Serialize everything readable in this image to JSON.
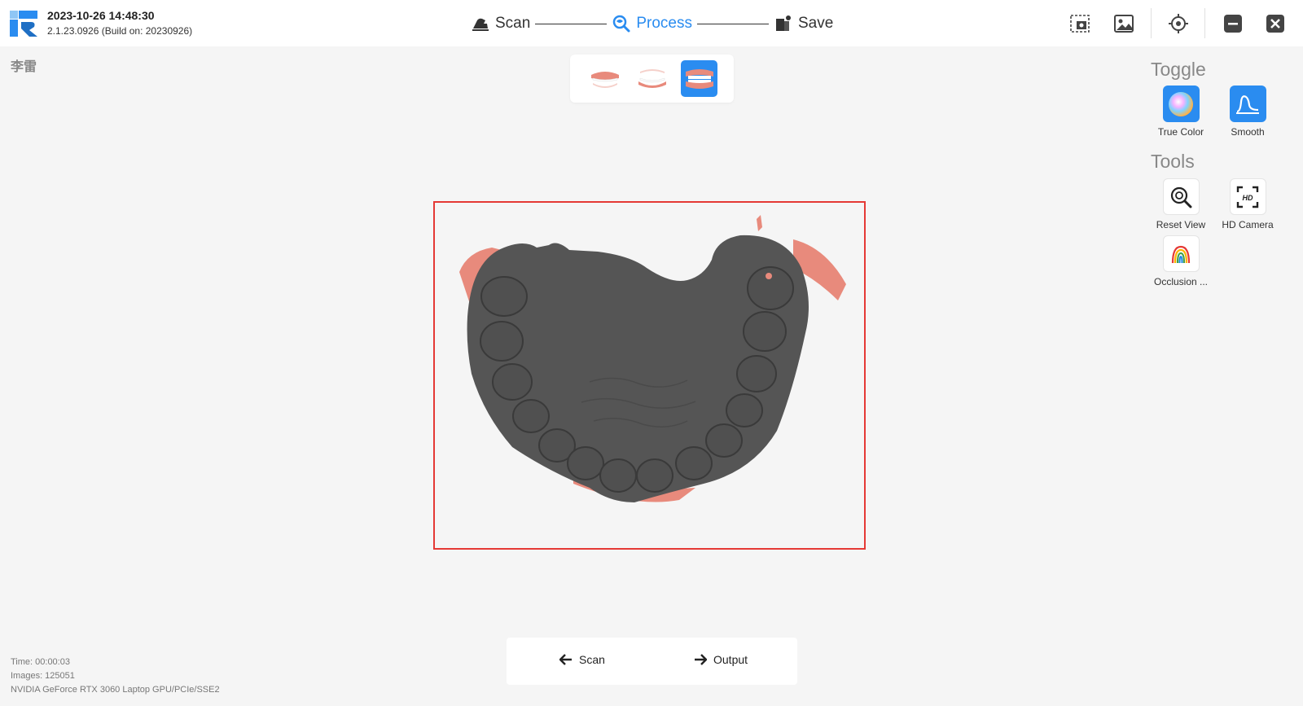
{
  "header": {
    "timestamp": "2023-10-26 14:48:30",
    "version": "2.1.23.0926 (Build on: 20230926)",
    "steps": [
      {
        "label": "Scan",
        "icon": "scanner-icon"
      },
      {
        "label": "Process",
        "icon": "process-icon",
        "active": true
      },
      {
        "label": "Save",
        "icon": "save-icon"
      }
    ],
    "right_icons": [
      "screenshot-icon",
      "image-gallery-icon",
      "target-icon",
      "minimize-icon",
      "close-icon"
    ]
  },
  "patient": {
    "name": "李雷"
  },
  "arch_selector": {
    "options": [
      "upper-jaw",
      "lower-jaw",
      "full-occlusion"
    ],
    "selected": "full-occlusion"
  },
  "right_panel": {
    "toggle_title": "Toggle",
    "toggles": [
      {
        "label": "True Color",
        "icon": "true-color-icon"
      },
      {
        "label": "Smooth",
        "icon": "smooth-icon"
      }
    ],
    "tools_title": "Tools",
    "tools": [
      {
        "label": "Reset View",
        "icon": "reset-view-icon"
      },
      {
        "label": "HD Camera",
        "icon": "hd-camera-icon"
      },
      {
        "label": "Occlusion ...",
        "icon": "occlusion-icon"
      }
    ]
  },
  "bottom_nav": {
    "back_label": "Scan",
    "next_label": "Output"
  },
  "status": {
    "time": "Time: 00:00:03",
    "images": "Images: 125051",
    "gpu": "NVIDIA GeForce RTX 3060 Laptop GPU/PCIe/SSE2"
  },
  "colors": {
    "accent": "#2a8cf0",
    "highlight_border": "#e53935",
    "model_gray": "#555555",
    "gum_pink": "#e88a7c"
  }
}
